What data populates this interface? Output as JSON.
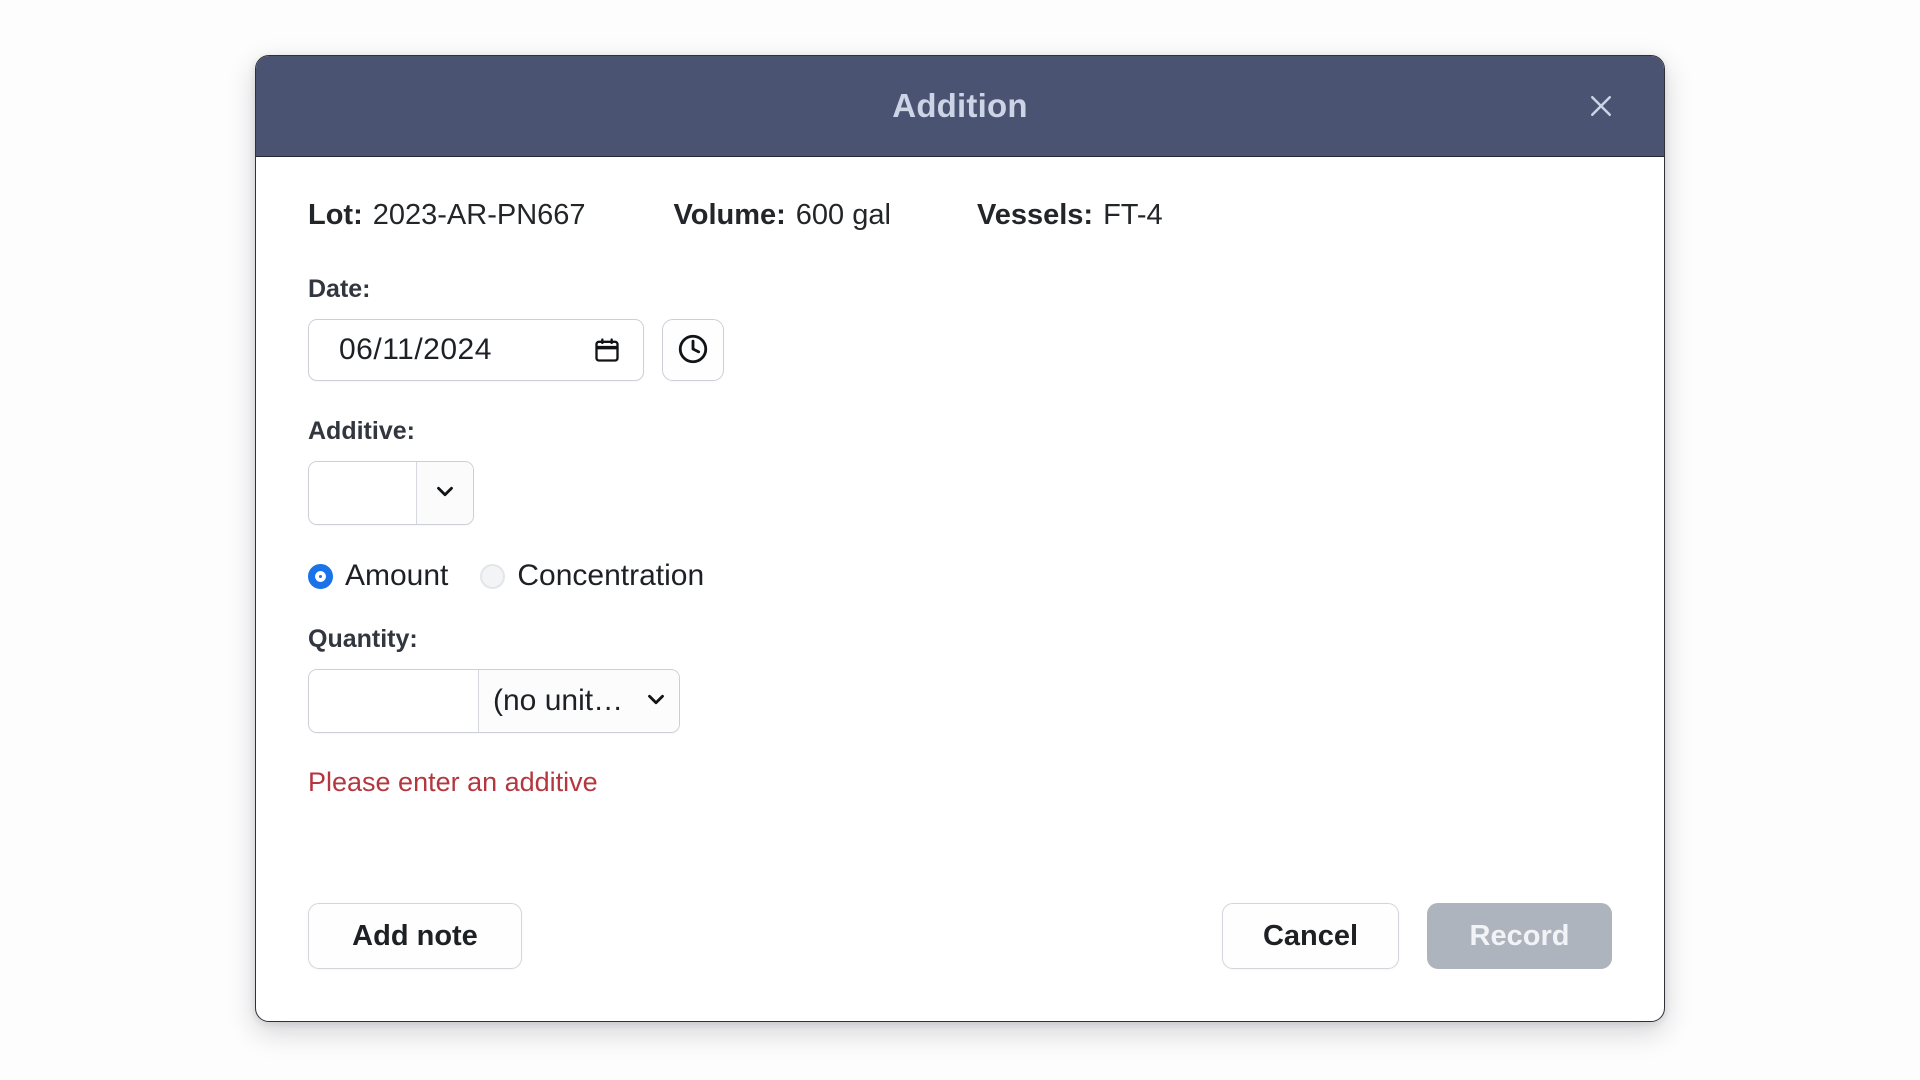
{
  "dialog": {
    "title": "Addition",
    "close_icon": "close-icon"
  },
  "info": {
    "lot_label": "Lot:",
    "lot_value": "2023-AR-PN667",
    "volume_label": "Volume:",
    "volume_value": "600 gal",
    "vessels_label": "Vessels:",
    "vessels_value": "FT-4"
  },
  "date_field": {
    "label": "Date:",
    "value": "06/11/2024",
    "calendar_icon": "calendar-icon",
    "time_button_icon": "clock-icon"
  },
  "additive_field": {
    "label": "Additive:",
    "value": "",
    "dropdown_icon": "chevron-down-icon"
  },
  "measure_mode": {
    "options": [
      {
        "label": "Amount",
        "selected": true
      },
      {
        "label": "Concentration",
        "selected": false
      }
    ],
    "accent_color": "#1a73e8"
  },
  "quantity_field": {
    "label": "Quantity:",
    "value": "",
    "unit_value": "(no unit…",
    "dropdown_icon": "chevron-down-icon"
  },
  "validation": {
    "message": "Please enter an additive",
    "color": "#b4373f"
  },
  "footer": {
    "add_note_label": "Add note",
    "cancel_label": "Cancel",
    "record_label": "Record",
    "record_disabled": true
  },
  "theme": {
    "header_bg": "#4a5472",
    "header_text": "#ccd4e6",
    "dialog_bg": "#ffffff",
    "page_bg": "#fdfdfd",
    "record_disabled_bg": "#aeb4bd"
  }
}
